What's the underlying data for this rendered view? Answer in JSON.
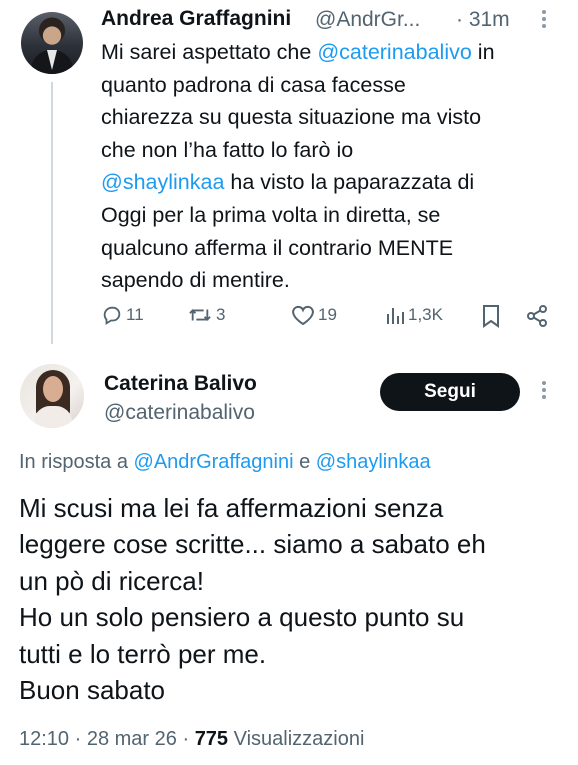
{
  "tweet1": {
    "author_name": "Andrea Graffagnini",
    "author_handle": "@AndrGr...",
    "time": "· 31m",
    "lines": [
      {
        "pre": "Mi sarei aspettato che ",
        "mention": "@caterinabalivo",
        "post": " in"
      },
      {
        "pre": "quanto padrona di casa facesse",
        "mention": "",
        "post": ""
      },
      {
        "pre": "chiarezza su questa situazione ma visto",
        "mention": "",
        "post": ""
      },
      {
        "pre": "che non l’ha fatto lo farò io",
        "mention": "",
        "post": ""
      },
      {
        "pre": "",
        "mention": "@shaylinkaa",
        "post": " ha visto la paparazzata di"
      },
      {
        "pre": "Oggi per la prima volta in diretta, se",
        "mention": "",
        "post": ""
      },
      {
        "pre": "qualcuno afferma il contrario MENTE",
        "mention": "",
        "post": ""
      },
      {
        "pre": "sapendo di mentire.",
        "mention": "",
        "post": ""
      }
    ],
    "actions": {
      "replies": "11",
      "reposts": "3",
      "likes": "19",
      "views": "1,3K"
    }
  },
  "tweet2": {
    "author_name": "Caterina Balivo",
    "author_handle": "@caterinabalivo",
    "follow_label": "Segui",
    "reply_prefix": "In risposta a ",
    "reply_mention1": "@AndrGraffagnini",
    "reply_and": " e ",
    "reply_mention2": "@shaylinkaa",
    "lines": [
      "Mi scusi ma lei fa affermazioni senza",
      "leggere cose scritte... siamo a sabato eh",
      "un pò di ricerca!",
      "Ho un solo pensiero a questo punto su",
      "tutti e lo terrò per me.",
      "Buon sabato"
    ],
    "meta": {
      "time": "12:10",
      "date": "28 mar 26",
      "views_count": "775",
      "views_label": "Visualizzazioni"
    }
  },
  "icons": {
    "reply": "reply-icon",
    "repost": "repost-icon",
    "like": "heart-icon",
    "views": "analytics-icon",
    "bookmark": "bookmark-icon",
    "share": "share-icon",
    "more": "more-icon"
  },
  "colors": {
    "text": "#0f1419",
    "secondary": "#536471",
    "link": "#1d9bf0",
    "button_bg": "#0f1419"
  }
}
